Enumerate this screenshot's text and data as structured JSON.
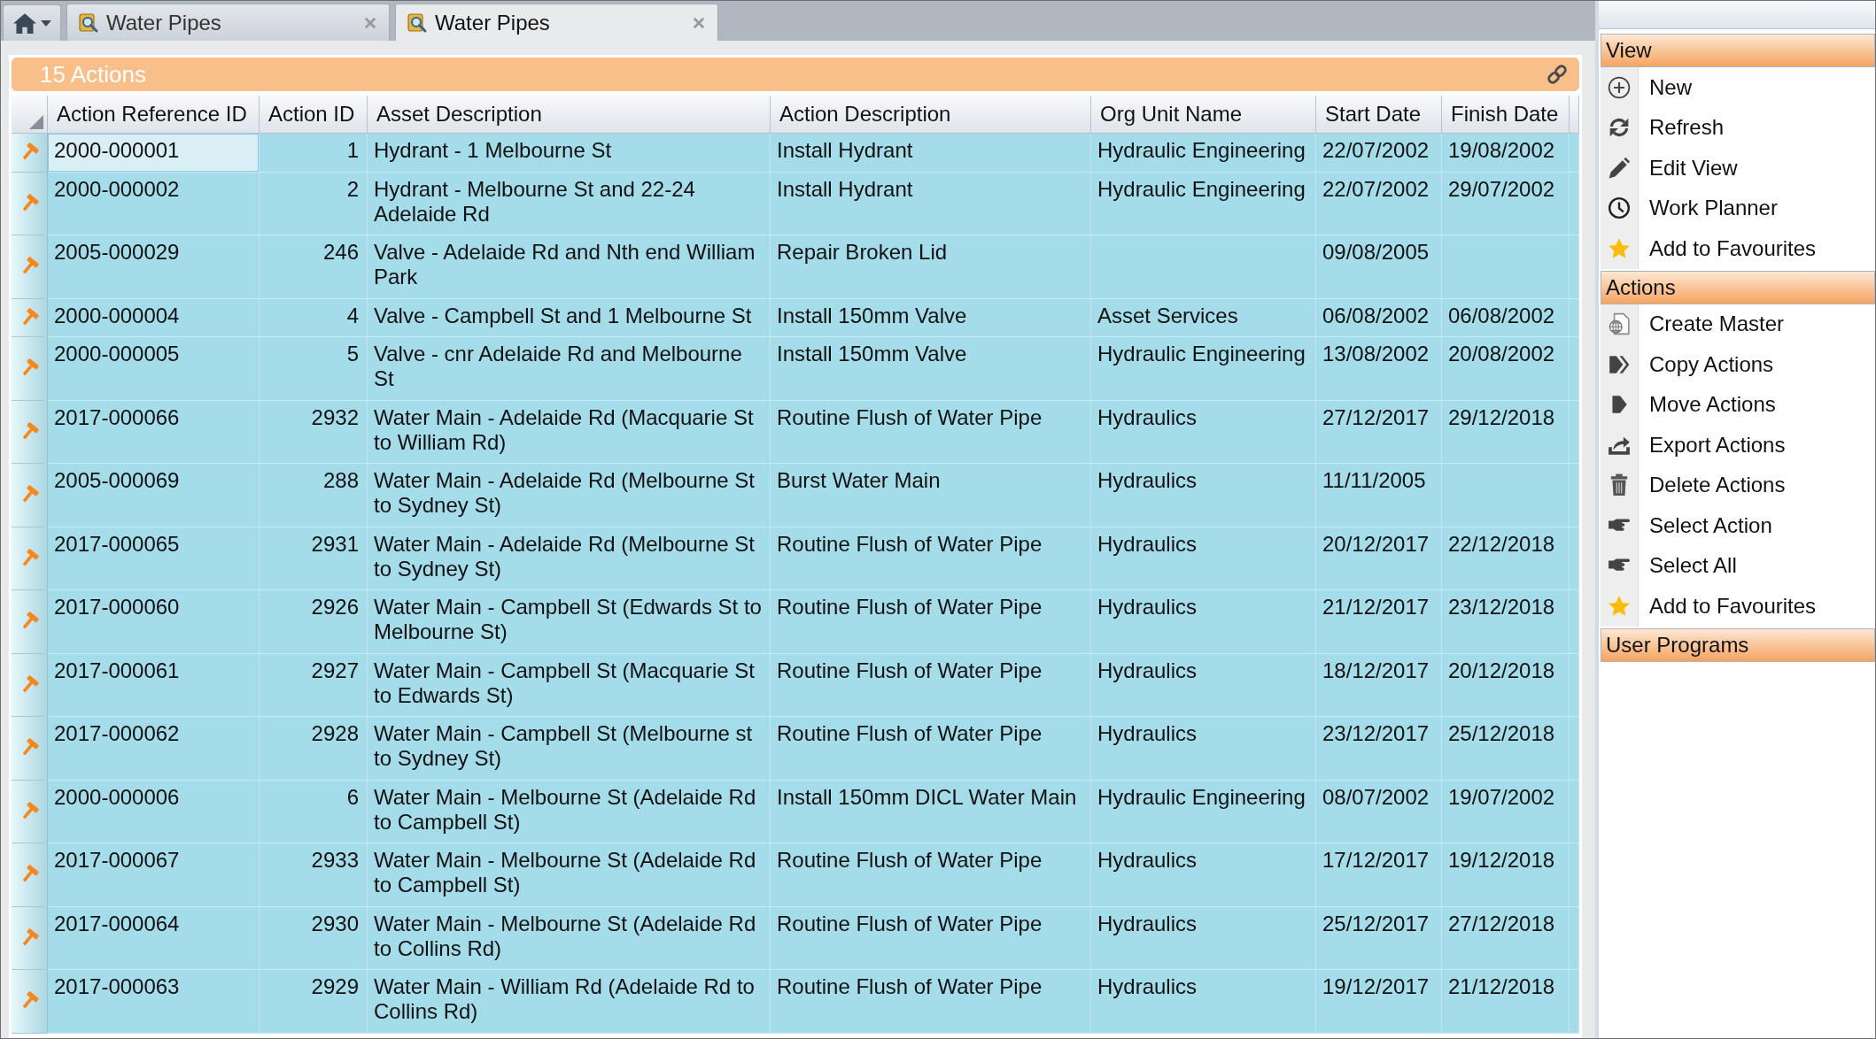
{
  "tabs": [
    {
      "label": "Water Pipes",
      "selected": false
    },
    {
      "label": "Water Pipes",
      "selected": true
    }
  ],
  "panel": {
    "title": "15 Actions"
  },
  "table": {
    "columns": [
      {
        "label": "Action Reference ID",
        "kind": "text"
      },
      {
        "label": "Action ID",
        "kind": "number"
      },
      {
        "label": "Asset Description",
        "kind": "text"
      },
      {
        "label": "Action Description",
        "kind": "text"
      },
      {
        "label": "Org Unit Name",
        "kind": "text"
      },
      {
        "label": "Start Date",
        "kind": "text"
      },
      {
        "label": "Finish Date",
        "kind": "text"
      }
    ],
    "rows": [
      {
        "selected": true,
        "cells": [
          "2000-000001",
          "1",
          "Hydrant - 1 Melbourne St",
          "Install Hydrant",
          "Hydraulic Engineering",
          "22/07/2002",
          "19/08/2002"
        ]
      },
      {
        "selected": false,
        "cells": [
          "2000-000002",
          "2",
          "Hydrant - Melbourne St and 22-24 Adelaide Rd",
          "Install Hydrant",
          "Hydraulic Engineering",
          "22/07/2002",
          "29/07/2002"
        ]
      },
      {
        "selected": false,
        "cells": [
          "2005-000029",
          "246",
          "Valve - Adelaide Rd and Nth end William Park",
          "Repair Broken Lid",
          null,
          "09/08/2005",
          null
        ]
      },
      {
        "selected": false,
        "cells": [
          "2000-000004",
          "4",
          "Valve - Campbell St and 1 Melbourne St",
          "Install 150mm Valve",
          "Asset Services",
          "06/08/2002",
          "06/08/2002"
        ]
      },
      {
        "selected": false,
        "cells": [
          "2000-000005",
          "5",
          "Valve - cnr Adelaide Rd and Melbourne St",
          "Install 150mm Valve",
          "Hydraulic Engineering",
          "13/08/2002",
          "20/08/2002"
        ]
      },
      {
        "selected": false,
        "cells": [
          "2017-000066",
          "2932",
          "Water Main - Adelaide Rd (Macquarie St to William Rd)",
          "Routine Flush of Water Pipe",
          "Hydraulics",
          "27/12/2017",
          "29/12/2018"
        ]
      },
      {
        "selected": false,
        "cells": [
          "2005-000069",
          "288",
          "Water Main - Adelaide Rd (Melbourne St to Sydney St)",
          "Burst Water Main",
          "Hydraulics",
          "11/11/2005",
          null
        ]
      },
      {
        "selected": false,
        "cells": [
          "2017-000065",
          "2931",
          "Water Main - Adelaide Rd (Melbourne St to Sydney St)",
          "Routine Flush of Water Pipe",
          "Hydraulics",
          "20/12/2017",
          "22/12/2018"
        ]
      },
      {
        "selected": false,
        "cells": [
          "2017-000060",
          "2926",
          "Water Main - Campbell St (Edwards St to Melbourne St)",
          "Routine Flush of Water Pipe",
          "Hydraulics",
          "21/12/2017",
          "23/12/2018"
        ]
      },
      {
        "selected": false,
        "cells": [
          "2017-000061",
          "2927",
          "Water Main - Campbell St (Macquarie St to Edwards St)",
          "Routine Flush of Water Pipe",
          "Hydraulics",
          "18/12/2017",
          "20/12/2018"
        ]
      },
      {
        "selected": false,
        "cells": [
          "2017-000062",
          "2928",
          "Water Main - Campbell St (Melbourne st to Sydney St)",
          "Routine Flush of Water Pipe",
          "Hydraulics",
          "23/12/2017",
          "25/12/2018"
        ]
      },
      {
        "selected": false,
        "cells": [
          "2000-000006",
          "6",
          "Water Main - Melbourne St (Adelaide Rd to Campbell St)",
          "Install 150mm DICL Water Main",
          "Hydraulic Engineering",
          "08/07/2002",
          "19/07/2002"
        ]
      },
      {
        "selected": false,
        "cells": [
          "2017-000067",
          "2933",
          "Water Main - Melbourne St (Adelaide Rd to Campbell St)",
          "Routine Flush of Water Pipe",
          "Hydraulics",
          "17/12/2017",
          "19/12/2018"
        ]
      },
      {
        "selected": false,
        "cells": [
          "2017-000064",
          "2930",
          "Water Main - Melbourne St (Adelaide Rd to Collins Rd)",
          "Routine Flush of Water Pipe",
          "Hydraulics",
          "25/12/2017",
          "27/12/2018"
        ]
      },
      {
        "selected": false,
        "cells": [
          "2017-000063",
          "2929",
          "Water Main - William Rd (Adelaide Rd to Collins Rd)",
          "Routine Flush of Water Pipe",
          "Hydraulics",
          "19/12/2017",
          "21/12/2018"
        ]
      }
    ]
  },
  "sidebar": {
    "sections": [
      {
        "title": "View",
        "items": [
          {
            "label": "New",
            "kind": "new"
          },
          {
            "label": "Refresh",
            "kind": "refresh"
          },
          {
            "label": "Edit View",
            "kind": "edit"
          },
          {
            "label": "Work Planner",
            "kind": "planner"
          },
          {
            "label": "Add to Favourites",
            "kind": "favourite"
          }
        ]
      },
      {
        "title": "Actions",
        "items": [
          {
            "label": "Create Master",
            "kind": "master"
          },
          {
            "label": "Copy Actions",
            "kind": "copy"
          },
          {
            "label": "Move Actions",
            "kind": "move"
          },
          {
            "label": "Export Actions",
            "kind": "export"
          },
          {
            "label": "Delete Actions",
            "kind": "delete"
          },
          {
            "label": "Select Action",
            "kind": "select"
          },
          {
            "label": "Select All",
            "kind": "select"
          },
          {
            "label": "Add to Favourites",
            "kind": "favourite"
          }
        ]
      },
      {
        "title": "User Programs"
      }
    ]
  }
}
